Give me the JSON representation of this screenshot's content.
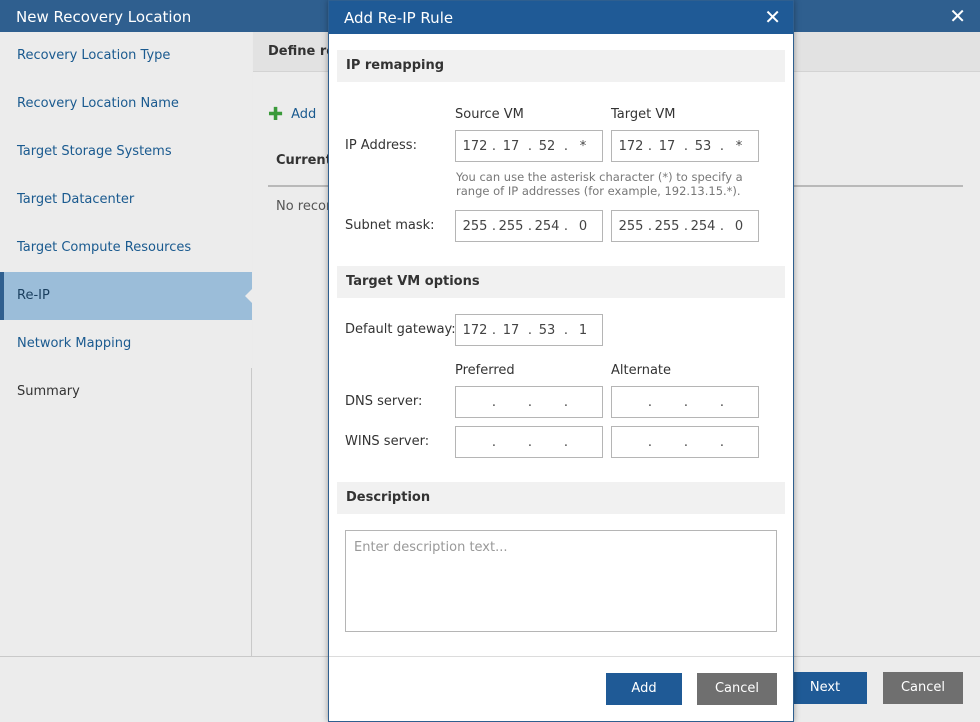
{
  "wizard": {
    "title": "New Recovery Location",
    "close": "✕",
    "steps": [
      {
        "label": "Recovery Location Type"
      },
      {
        "label": "Recovery Location Name"
      },
      {
        "label": "Target Storage Systems"
      },
      {
        "label": "Target Datacenter"
      },
      {
        "label": "Target Compute Resources"
      },
      {
        "label": "Re-IP"
      },
      {
        "label": "Network Mapping"
      },
      {
        "label": "Summary"
      }
    ],
    "header": "Define re",
    "add_label": "Add",
    "current_label": "Current",
    "no_records": "No recor",
    "next_label": "Next",
    "cancel_label": "Cancel"
  },
  "dialog": {
    "title": "Add Re-IP Rule",
    "close": "✕",
    "ip_section": "IP remapping",
    "source_col": "Source VM",
    "target_col": "Target VM",
    "ip_label": "IP Address:",
    "source_ip": [
      "172",
      "17",
      "52",
      "*"
    ],
    "target_ip": [
      "172",
      "17",
      "53",
      "*"
    ],
    "hint": "You can use the asterisk character (*) to specify a range of IP addresses (for example, 192.13.15.*).",
    "subnet_label": "Subnet mask:",
    "source_mask": [
      "255",
      "255",
      "254",
      "0"
    ],
    "target_mask": [
      "255",
      "255",
      "254",
      "0"
    ],
    "vm_section": "Target VM options",
    "gateway_label": "Default gateway:",
    "gateway": [
      "172",
      "17",
      "53",
      "1"
    ],
    "preferred_col": "Preferred",
    "alternate_col": "Alternate",
    "dns_label": "DNS server:",
    "wins_label": "WINS server:",
    "empty_ip": [
      "",
      "",
      "",
      ""
    ],
    "desc_section": "Description",
    "desc_placeholder": "Enter description text...",
    "add_label": "Add",
    "cancel_label": "Cancel"
  },
  "colors": {
    "title_bar": "#2f5f8f",
    "dialog_title": "#1f5a96",
    "active_step": "#9bbdd9",
    "primary_button": "#1f5a96",
    "secondary_button": "#6f6f6f"
  }
}
